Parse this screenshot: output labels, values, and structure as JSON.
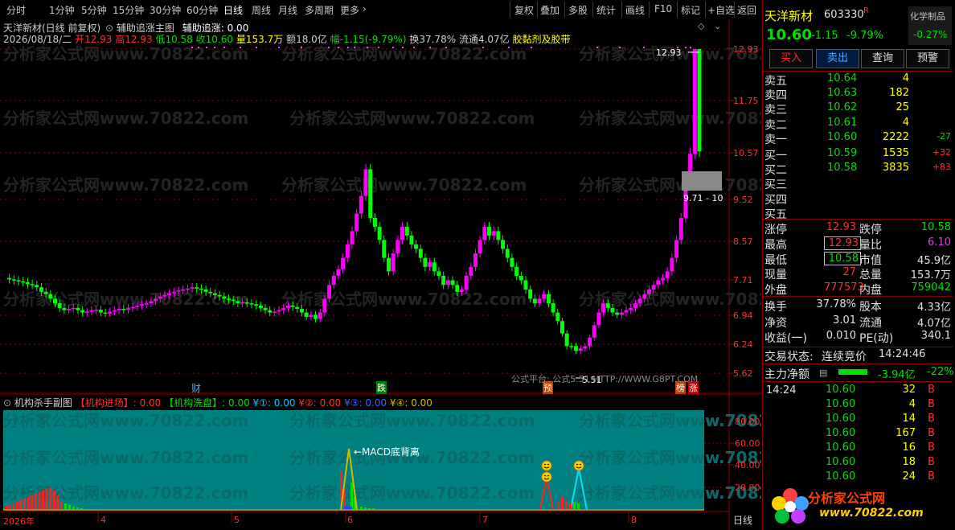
{
  "toolbar": {
    "periods": [
      "分时",
      "1分钟",
      "5分钟",
      "15分钟",
      "30分钟",
      "60分钟",
      "日线",
      "周线",
      "月线",
      "多周期",
      "更多"
    ],
    "active": "日线",
    "tools": [
      "复权",
      "叠加",
      "多股",
      "统计",
      "画线",
      "F10",
      "标记",
      "+自选",
      "返回"
    ]
  },
  "main": {
    "title": "天洋新材(日线 前复权)",
    "indicator_name": "辅助追涨主图",
    "indicator_value": "辅助追涨: 0.00",
    "date": "2026/08/18/二",
    "open_lbl": "开",
    "open": "12.93",
    "high_lbl": "高",
    "high": "12.93",
    "low_lbl": "低",
    "low": "10.58",
    "close_lbl": "收",
    "close": "10.60",
    "vol_lbl": "量",
    "vol": "153.7万",
    "amt_lbl": "额",
    "amt": "18.0亿",
    "chg": "幅-1.15(-9.79%)",
    "turn": "换37.78%",
    "float": "流通4.07亿",
    "concept": "胶黏剂及胶带",
    "price_axis": [
      "12.93",
      "11.75",
      "10.57",
      "9.52",
      "8.57",
      "7.71",
      "6.94",
      "6.24",
      "5.62"
    ],
    "max_label": "12.93",
    "min_label": "5.51",
    "range_label": "9.71 - 10",
    "markers": [
      {
        "text": "财",
        "color": "#4aa8ff"
      },
      {
        "text": "跌",
        "color": "#ffffff"
      },
      {
        "text": "预",
        "color": "#ffffff"
      },
      {
        "text": "榜",
        "color": "#ffffff"
      },
      {
        "text": "涨",
        "color": "#ffffff"
      }
    ],
    "footer_note": "公式平台: 公式5.51    HTTP://WWW.G8PT.COM"
  },
  "sub": {
    "title": "机构杀手副图",
    "items": [
      {
        "label": "【机构进场】: 0.00",
        "color": "#ff3030"
      },
      {
        "label": "【机构洗盘】: 0.00",
        "color": "#00e000"
      },
      {
        "label": "¥①: 0.00",
        "color": "#00c8ff"
      },
      {
        "label": "¥②: 0.00",
        "color": "#ff3030"
      },
      {
        "label": "¥③: 0.00",
        "color": "#4060ff"
      },
      {
        "label": "¥④: 0.00",
        "color": "#c8c000"
      }
    ],
    "axis": [
      "80.00",
      "60.00",
      "40.00",
      "20.00"
    ],
    "annotation": "←MACD底背离",
    "period_tag": "日线",
    "xlabels": [
      "2026年",
      "4",
      "5",
      "6",
      "7",
      "8"
    ]
  },
  "stock": {
    "name": "天洋新材",
    "code": "603330",
    "flag": "R",
    "sector": "化学制品",
    "sector_pct": "-0.27%",
    "price": "10.60",
    "chg": "-1.15",
    "pct": "-9.79%"
  },
  "actions": [
    "买入",
    "卖出",
    "查询",
    "预警"
  ],
  "asks": [
    {
      "label": "卖五",
      "price": "10.64",
      "vol": "4",
      "delta": ""
    },
    {
      "label": "卖四",
      "price": "10.63",
      "vol": "182",
      "delta": ""
    },
    {
      "label": "卖三",
      "price": "10.62",
      "vol": "25",
      "delta": ""
    },
    {
      "label": "卖二",
      "price": "10.61",
      "vol": "4",
      "delta": ""
    },
    {
      "label": "卖一",
      "price": "10.60",
      "vol": "2222",
      "delta": "-27"
    }
  ],
  "bids": [
    {
      "label": "买一",
      "price": "10.59",
      "vol": "1535",
      "delta": "+32"
    },
    {
      "label": "买二",
      "price": "10.58",
      "vol": "3835",
      "delta": "+83"
    },
    {
      "label": "买三",
      "price": "",
      "vol": "",
      "delta": ""
    },
    {
      "label": "买四",
      "price": "",
      "vol": "",
      "delta": ""
    },
    {
      "label": "买五",
      "price": "",
      "vol": "",
      "delta": ""
    }
  ],
  "quote": [
    {
      "l1": "涨停",
      "v1": "12.93",
      "c1": "#ff3030",
      "l2": "跌停",
      "v2": "10.58",
      "c2": "#00e000"
    },
    {
      "l1": "最高",
      "v1": "12.93",
      "c1": "#ff3030",
      "l2": "量比",
      "v2": "6.10",
      "c2": "#e040e0"
    },
    {
      "l1": "最低",
      "v1": "10.58",
      "c1": "#00e000",
      "l2": "市值",
      "v2": "45.9亿",
      "c2": "#e0e0e0"
    },
    {
      "l1": "现量",
      "v1": "27",
      "c1": "#ff3030",
      "l2": "总量",
      "v2": "153.7万",
      "c2": "#e0e0e0"
    },
    {
      "l1": "外盘",
      "v1": "777573",
      "c1": "#ff3030",
      "l2": "内盘",
      "v2": "759042",
      "c2": "#00e000"
    }
  ],
  "fund": [
    {
      "l1": "换手",
      "v1": "37.78%",
      "l2": "股本",
      "v2": "4.33亿"
    },
    {
      "l1": "净资",
      "v1": "3.01",
      "l2": "流通",
      "v2": "4.07亿"
    },
    {
      "l1": "收益(一)",
      "v1": "0.010",
      "l2": "PE(动)",
      "v2": "340.1"
    }
  ],
  "status": {
    "label": "交易状态:",
    "value": "连续竞价",
    "time": "14:24:46"
  },
  "netflow": {
    "label": "主力净额",
    "value": "-3.94亿",
    "pct": "-22%"
  },
  "ticks_time": "14:24",
  "ticks": [
    {
      "price": "10.60",
      "vol": "32",
      "side": "B"
    },
    {
      "price": "10.60",
      "vol": "4",
      "side": "B"
    },
    {
      "price": "10.60",
      "vol": "14",
      "side": "B"
    },
    {
      "price": "10.60",
      "vol": "167",
      "side": "B"
    },
    {
      "price": "10.60",
      "vol": "16",
      "side": "B"
    },
    {
      "price": "10.60",
      "vol": "18",
      "side": "B"
    },
    {
      "price": "10.60",
      "vol": "24",
      "side": "B"
    }
  ],
  "logo": {
    "name": "分析家公式网",
    "url": "www.70822.com"
  },
  "colors": {
    "up": "#ff00ff",
    "down": "#00ff00",
    "sub_bg": "#008080",
    "grid": "#8b0000"
  }
}
